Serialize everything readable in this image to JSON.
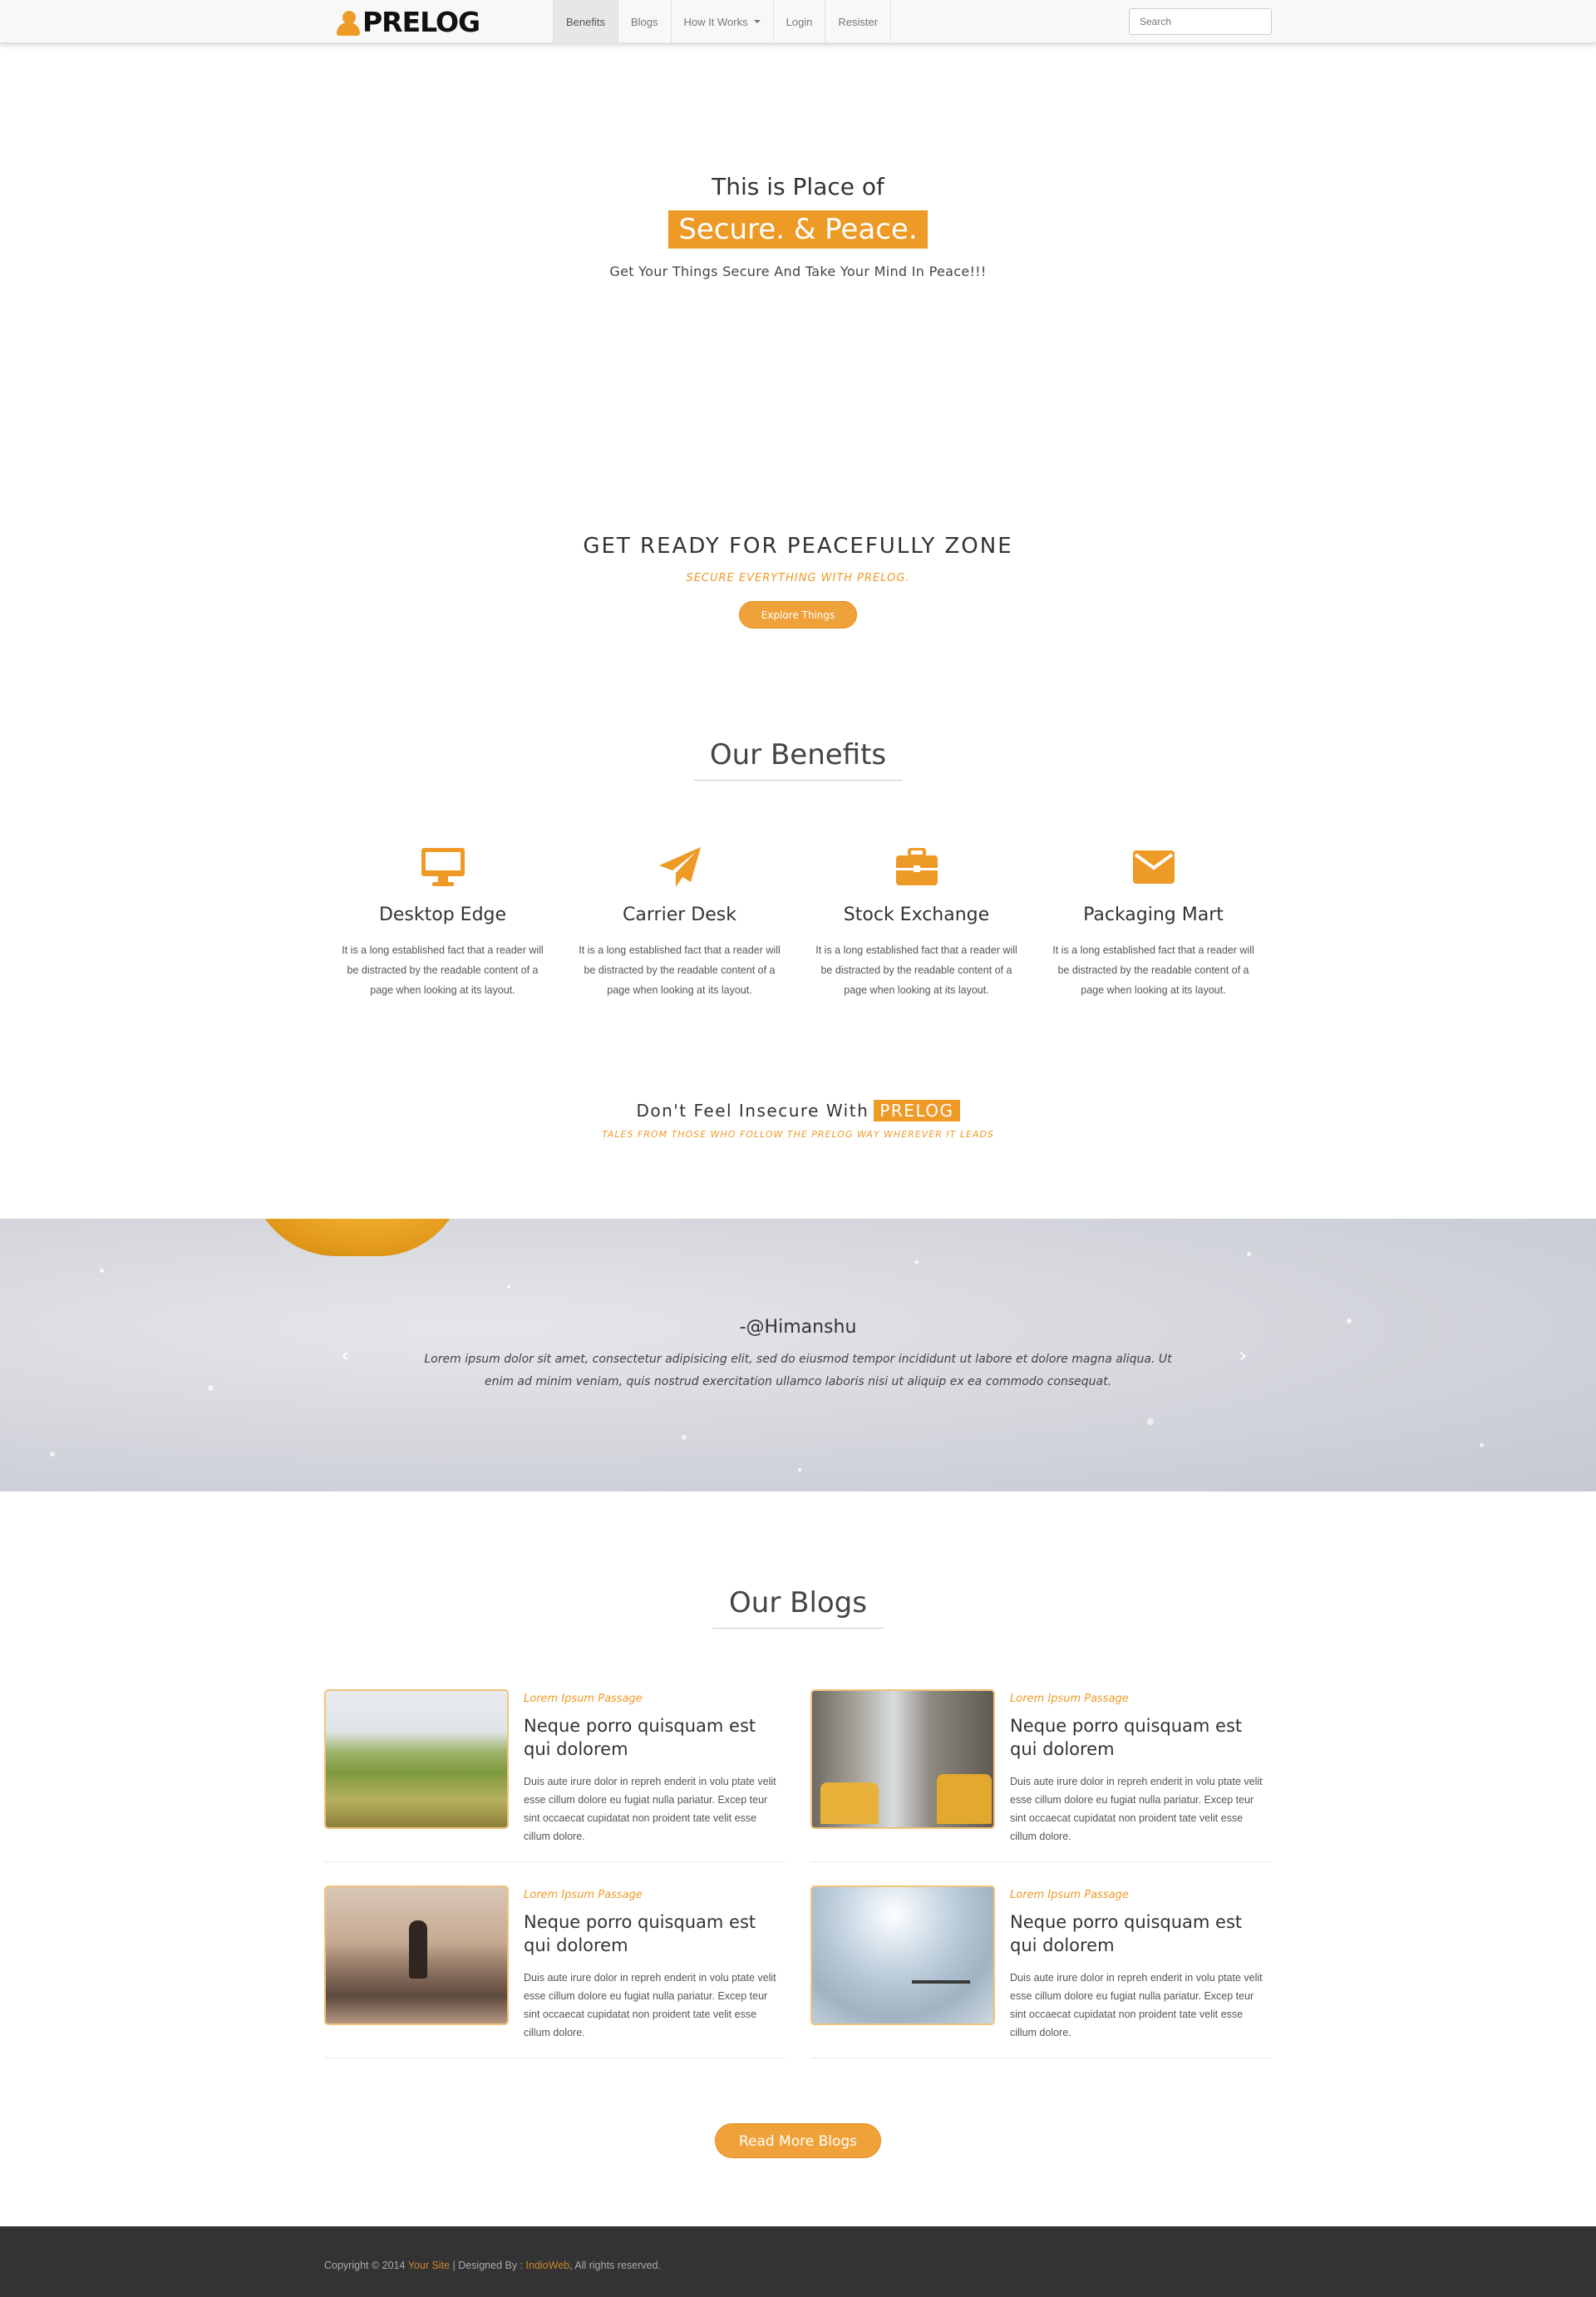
{
  "colors": {
    "accent": "#ee9a27",
    "footer_bg": "#333333",
    "nav_bg": "#f8f8f8"
  },
  "navbar": {
    "brand": "PRELOG",
    "brand_icon": "user-icon",
    "items": [
      {
        "label": "Benefits",
        "active": true
      },
      {
        "label": "Blogs"
      },
      {
        "label": "How It Works",
        "dropdown": true
      },
      {
        "label": "Login"
      },
      {
        "label": "Resister"
      }
    ],
    "search_placeholder": "Search"
  },
  "hero": {
    "line1": "This is Place of",
    "highlight": "Secure. & Peace.",
    "subtitle": "Get Your Things Secure And Take Your Mind In Peace!!!"
  },
  "ready": {
    "title": "GET READY FOR PEACEFULLY ZONE",
    "subtitle": "SECURE EVERYTHING WITH PRELOG.",
    "button": "Explore Things"
  },
  "benefits": {
    "title": "Our Benefits",
    "items": [
      {
        "icon": "desktop-icon",
        "title": "Desktop Edge",
        "text": "It is a long established fact that a reader will be distracted by the readable content of a page when looking at its layout."
      },
      {
        "icon": "paper-plane-icon",
        "title": "Carrier Desk",
        "text": "It is a long established fact that a reader will be distracted by the readable content of a page when looking at its layout."
      },
      {
        "icon": "briefcase-icon",
        "title": "Stock Exchange",
        "text": "It is a long established fact that a reader will be distracted by the readable content of a page when looking at its layout."
      },
      {
        "icon": "envelope-icon",
        "title": "Packaging Mart",
        "text": "It is a long established fact that a reader will be distracted by the readable content of a page when looking at its layout."
      }
    ]
  },
  "insecure": {
    "title": "Don't Feel Insecure With",
    "highlight": "PRELOG",
    "subtitle": "TALES FROM THOSE WHO FOLLOW THE PRELOG WAY WHEREVER IT LEADS"
  },
  "testimonial": {
    "author": "-@Himanshu",
    "quote": "Lorem ipsum dolor sit amet, consectetur adipisicing elit, sed do eiusmod tempor incididunt ut labore et dolore magna aliqua. Ut enim ad minim veniam, quis nostrud exercitation ullamco laboris nisi ut aliquip ex ea commodo consequat.",
    "prev": "‹",
    "next": "›"
  },
  "blogs": {
    "title": "Our Blogs",
    "posts": [
      {
        "tag": "Lorem Ipsum Passage",
        "title": "Neque porro quisquam est qui dolorem",
        "text": "Duis aute irure dolor in repreh enderit in volu ptate velit esse cillum dolore eu fugiat nulla pariatur. Excep teur sint occaecat cupidatat non proident tate velit esse cillum dolore."
      },
      {
        "tag": "Lorem Ipsum Passage",
        "title": "Neque porro quisquam est qui dolorem",
        "text": "Duis aute irure dolor in repreh enderit in volu ptate velit esse cillum dolore eu fugiat nulla pariatur. Excep teur sint occaecat cupidatat non proident tate velit esse cillum dolore."
      },
      {
        "tag": "Lorem Ipsum Passage",
        "title": "Neque porro quisquam est qui dolorem",
        "text": "Duis aute irure dolor in repreh enderit in volu ptate velit esse cillum dolore eu fugiat nulla pariatur. Excep teur sint occaecat cupidatat non proident tate velit esse cillum dolore."
      },
      {
        "tag": "Lorem Ipsum Passage",
        "title": "Neque porro quisquam est qui dolorem",
        "text": "Duis aute irure dolor in repreh enderit in volu ptate velit esse cillum dolore eu fugiat nulla pariatur. Excep teur sint occaecat cupidatat non proident tate velit esse cillum dolore."
      }
    ],
    "read_more": "Read More Blogs"
  },
  "footer": {
    "copyright": "Copyright © 2014",
    "site_link": "Your Site",
    "separator": "| Designed By :",
    "designer_link": "IndioWeb",
    "rights": ", All rights reserved."
  }
}
